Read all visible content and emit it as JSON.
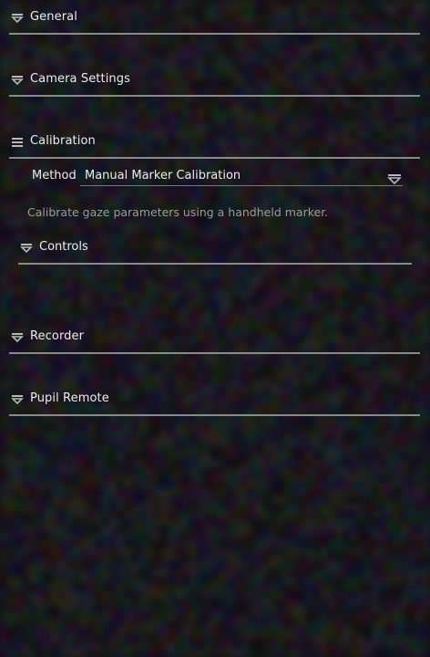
{
  "sections": {
    "general": {
      "label": "General",
      "icon": "collapse-toggle-icon",
      "state": "collapsed"
    },
    "camera_settings": {
      "label": "Camera Settings",
      "icon": "collapse-toggle-icon",
      "state": "collapsed"
    },
    "calibration": {
      "label": "Calibration",
      "icon": "menu-lines-icon",
      "state": "expanded",
      "method": {
        "label": "Method",
        "value": "Manual Marker Calibration",
        "icon": "dropdown-icon"
      },
      "description": "Calibrate gaze parameters using a handheld marker.",
      "controls": {
        "label": "Controls",
        "icon": "collapse-toggle-icon",
        "state": "collapsed"
      }
    },
    "recorder": {
      "label": "Recorder",
      "icon": "collapse-toggle-icon",
      "state": "collapsed"
    },
    "pupil_remote": {
      "label": "Pupil Remote",
      "icon": "collapse-toggle-icon",
      "state": "collapsed"
    }
  },
  "colors": {
    "text": "#ececec",
    "muted_text": "#9c9c9c",
    "divider": "#8a8a8a"
  }
}
